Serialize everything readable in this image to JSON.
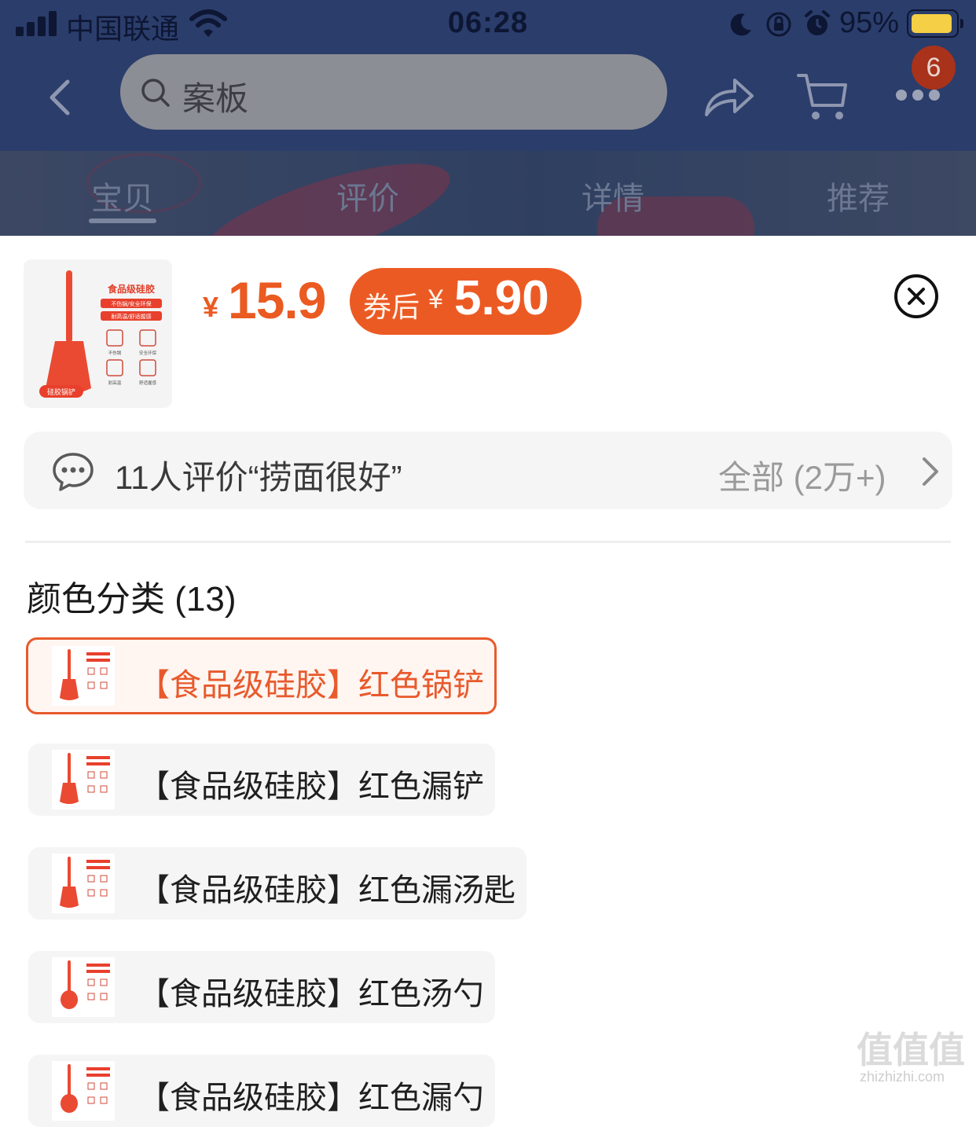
{
  "status_bar": {
    "carrier": "中国联通",
    "time": "06:28",
    "battery_percent": "95%",
    "battery_level": 0.95,
    "icons": [
      "signal-icon",
      "wifi-icon",
      "moon-icon",
      "rotation-lock-icon",
      "alarm-icon",
      "battery-icon"
    ]
  },
  "nav": {
    "search_text": "案板",
    "cart_badge": "6",
    "icons": [
      "back-icon",
      "search-icon",
      "share-icon",
      "cart-icon",
      "more-icon"
    ]
  },
  "tabs": [
    {
      "label": "宝贝",
      "active": true
    },
    {
      "label": "评价",
      "active": false
    },
    {
      "label": "详情",
      "active": false
    },
    {
      "label": "推荐",
      "active": false
    }
  ],
  "product": {
    "currency": "¥",
    "price": "15.9",
    "coupon_label": "券后",
    "coupon_currency": "¥",
    "coupon_price": "5.90",
    "thumb_text": {
      "title": "食品级硅胶",
      "line1": "不伤锅/安全环保",
      "line2": "耐高温/舒适握感",
      "feat1": "不伤锅",
      "feat2": "安全环保",
      "feat3": "耐高温",
      "feat4": "舒适握感",
      "tag": "硅胶锅铲"
    }
  },
  "review": {
    "text": "11人评价“捞面很好”",
    "all_label": "全部 (2万+)"
  },
  "variants": {
    "title": "颜色分类 (13)",
    "options": [
      {
        "label": "【食品级硅胶】红色锅铲",
        "selected": true
      },
      {
        "label": "【食品级硅胶】红色漏铲",
        "selected": false
      },
      {
        "label": "【食品级硅胶】红色漏汤匙",
        "selected": false
      },
      {
        "label": "【食品级硅胶】红色汤勺",
        "selected": false
      },
      {
        "label": "【食品级硅胶】红色漏勺",
        "selected": false
      }
    ]
  },
  "watermark": {
    "main": "值值值",
    "sub": "zhizhizhi.com"
  },
  "colors": {
    "accent": "#ea5a21",
    "header": "#2b3d6b",
    "coupon": "#ec5a24"
  }
}
